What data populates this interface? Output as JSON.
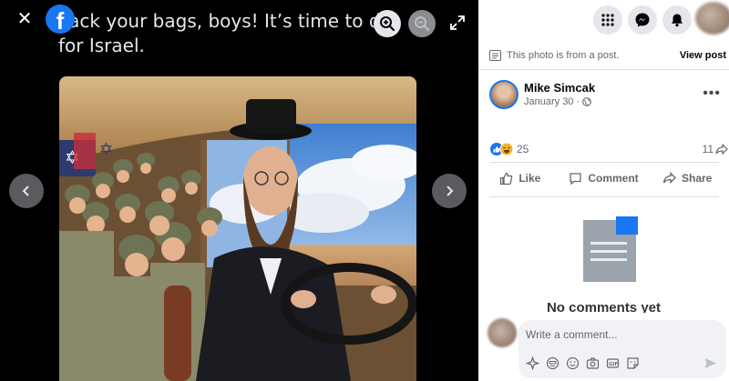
{
  "viewer": {
    "meme_text": "Pack your bags, boys! It’s time to die for Israel.",
    "fb_logo_letter": "f"
  },
  "panel": {
    "notice": "This photo is from a post.",
    "view_post": "View post",
    "author": {
      "name": "Mike Simcak",
      "date": "January 30 ·"
    },
    "reactions": {
      "count": "25",
      "shares": "11"
    },
    "actions": {
      "like": "Like",
      "comment": "Comment",
      "share": "Share"
    },
    "empty_state": "No comments yet",
    "comment_input": {
      "placeholder": "Write a comment..."
    }
  },
  "colors": {
    "accent": "#1877f2",
    "viewer_bg": "#000000",
    "panel_bg": "#ffffff",
    "muted": "#65676b"
  },
  "icons": [
    "close-icon",
    "facebook-logo",
    "zoom-in-icon",
    "zoom-out-icon",
    "expand-icon",
    "chevron-left-icon",
    "chevron-right-icon",
    "menu-grid-icon",
    "messenger-icon",
    "bell-icon",
    "document-icon",
    "more-icon",
    "globe-icon",
    "like-icon",
    "haha-icon",
    "share-icon",
    "comment-icon",
    "avatar-icon",
    "sticker-icon",
    "emoji-icon",
    "camera-icon",
    "gif-icon",
    "send-icon"
  ]
}
